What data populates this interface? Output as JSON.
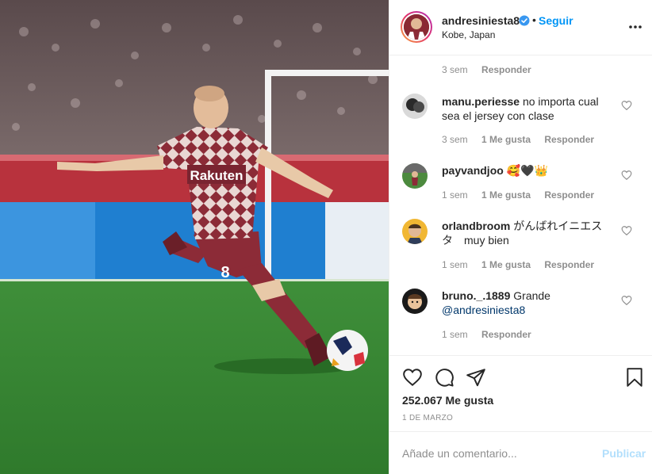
{
  "post": {
    "username": "andresiniesta8",
    "dot": "•",
    "follow_label": "Seguir",
    "location": "Kobe, Japan"
  },
  "jersey": {
    "sponsor": "Rakuten",
    "number": "8"
  },
  "caption_meta": {
    "time": "3 sem",
    "reply_label": "Responder"
  },
  "comments": [
    {
      "user": "manu.periesse",
      "text": "no importa cual sea el jersey con clase",
      "time": "3 sem",
      "likes": "1 Me gusta",
      "reply": "Responder"
    },
    {
      "user": "payvandjoo",
      "text": "🥰🖤👑",
      "time": "1 sem",
      "likes": "1 Me gusta",
      "reply": "Responder"
    },
    {
      "user": "orlandbroom",
      "text": "がんばれイニエスタ　muy bien",
      "time": "1 sem",
      "likes": "1 Me gusta",
      "reply": "Responder"
    },
    {
      "user": "bruno._.1889",
      "text": "Grande",
      "mention": "@andresiniesta8",
      "time": "1 sem",
      "reply": "Responder"
    }
  ],
  "actions": {
    "likes": "252.067 Me gusta",
    "date": "1 DE MARZO"
  },
  "add_comment": {
    "placeholder": "Añade un comentario...",
    "publish_label": "Publicar"
  },
  "icons": {
    "verified": "verified-badge-icon",
    "more": "more-options-icon",
    "like": "heart-icon",
    "comment": "comment-icon",
    "share": "share-icon",
    "save": "bookmark-icon"
  },
  "colors": {
    "accent": "#0095f6",
    "jersey": "#8c2b37",
    "publish_disabled": "#b2dffc",
    "muted": "#8e8e8e"
  }
}
